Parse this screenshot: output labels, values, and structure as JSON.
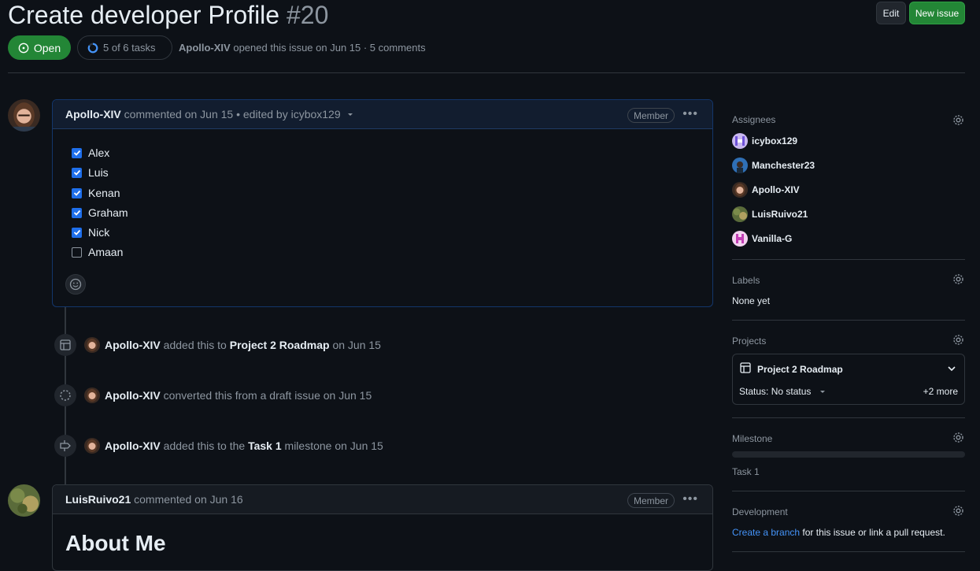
{
  "header": {
    "title": "Create developer Profile",
    "number": "#20",
    "edit_label": "Edit",
    "new_issue_label": "New issue",
    "state": "Open",
    "tasks": "5 of 6 tasks",
    "author": "Apollo-XIV",
    "opened_text": "opened this issue on Jun 15 · 5 comments"
  },
  "comment1": {
    "author": "Apollo-XIV",
    "meta": "commented on Jun 15 • edited by icybox129",
    "badge": "Member",
    "tasks": [
      {
        "label": "Alex",
        "checked": true
      },
      {
        "label": "Luis",
        "checked": true
      },
      {
        "label": "Kenan",
        "checked": true
      },
      {
        "label": "Graham",
        "checked": true
      },
      {
        "label": "Nick",
        "checked": true
      },
      {
        "label": "Amaan",
        "checked": false
      }
    ]
  },
  "events": [
    {
      "actor": "Apollo-XIV",
      "pre": "added this to",
      "target": "Project 2 Roadmap",
      "post": "on Jun 15",
      "icon": "table-icon"
    },
    {
      "actor": "Apollo-XIV",
      "pre": "converted this from a draft issue on Jun 15",
      "target": "",
      "post": "",
      "icon": "draft-circle-icon"
    },
    {
      "actor": "Apollo-XIV",
      "pre": "added this to the",
      "target": "Task 1",
      "post": "milestone on Jun 15",
      "icon": "milestone-icon"
    }
  ],
  "comment2": {
    "author": "LuisRuivo21",
    "meta": "commented on Jun 16",
    "badge": "Member",
    "heading": "About Me"
  },
  "sidebar": {
    "assignees_label": "Assignees",
    "assignees": [
      "icybox129",
      "Manchester23",
      "Apollo-XIV",
      "LuisRuivo21",
      "Vanilla-G"
    ],
    "labels_label": "Labels",
    "labels_value": "None yet",
    "projects_label": "Projects",
    "project_name": "Project 2 Roadmap",
    "project_status": "Status: No status",
    "project_more": "+2 more",
    "milestone_label": "Milestone",
    "milestone_value": "Task 1",
    "development_label": "Development",
    "development_link": "Create a branch",
    "development_text": "for this issue or link a pull request."
  },
  "colors": {
    "background": "#0d1117",
    "open_green": "#238636",
    "checkbox_blue": "#1f6feb",
    "link_blue": "#4493f8"
  }
}
